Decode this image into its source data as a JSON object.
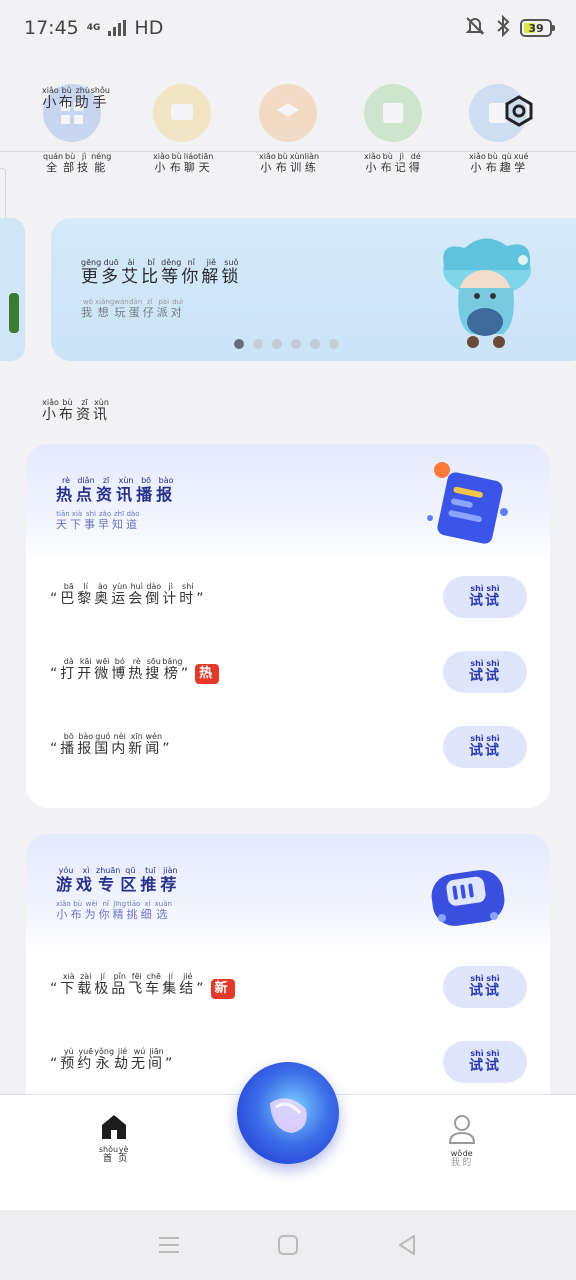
{
  "status_bar": {
    "time": "17:45",
    "network": "4G",
    "hd": "HD",
    "battery": "39"
  },
  "header": {
    "title": [
      {
        "h": "小",
        "p": "xiǎo"
      },
      {
        "h": "布",
        "p": "bù"
      },
      {
        "h": "助",
        "p": "zhù"
      },
      {
        "h": "手",
        "p": "shǒu"
      }
    ],
    "settings_icon": "settings-hexagon-icon"
  },
  "skills": [
    {
      "id": "all",
      "color": "#5f8ee6",
      "icon": "grid-icon",
      "label": [
        {
          "h": "全",
          "p": "quán"
        },
        {
          "h": "部",
          "p": "bù"
        },
        {
          "h": "技",
          "p": "jì"
        },
        {
          "h": "能",
          "p": "néng"
        }
      ]
    },
    {
      "id": "chat",
      "color": "#f2c44c",
      "icon": "chat-icon",
      "label": [
        {
          "h": "小",
          "p": "xiǎo"
        },
        {
          "h": "布",
          "p": "bù"
        },
        {
          "h": "聊",
          "p": "liáo"
        },
        {
          "h": "天",
          "p": "tiān"
        }
      ]
    },
    {
      "id": "train",
      "color": "#f3a050",
      "icon": "layers-icon",
      "label": [
        {
          "h": "小",
          "p": "xiǎo"
        },
        {
          "h": "布",
          "p": "bù"
        },
        {
          "h": "训",
          "p": "xùn"
        },
        {
          "h": "练",
          "p": "liàn"
        }
      ]
    },
    {
      "id": "notes",
      "color": "#6fc36a",
      "icon": "list-icon",
      "label": [
        {
          "h": "小",
          "p": "xiǎo"
        },
        {
          "h": "布",
          "p": "bù"
        },
        {
          "h": "记",
          "p": "jì"
        },
        {
          "h": "得",
          "p": "dé"
        }
      ]
    },
    {
      "id": "fun",
      "color": "#76a8f0",
      "icon": "book-icon",
      "label": [
        {
          "h": "小",
          "p": "xiǎo"
        },
        {
          "h": "布",
          "p": "bù"
        },
        {
          "h": "趣",
          "p": "qù"
        },
        {
          "h": "学",
          "p": "xué"
        }
      ]
    }
  ],
  "banner": {
    "title": [
      {
        "h": "更",
        "p": "gēng"
      },
      {
        "h": "多",
        "p": "duō"
      },
      {
        "h": "艾",
        "p": "ài"
      },
      {
        "h": "比",
        "p": "bǐ"
      },
      {
        "h": "等",
        "p": "děng"
      },
      {
        "h": "你",
        "p": "nǐ"
      },
      {
        "h": "解",
        "p": "jiě"
      },
      {
        "h": "锁",
        "p": "suǒ"
      }
    ],
    "subtitle": [
      {
        "h": "我",
        "p": "wǒ"
      },
      {
        "h": "想",
        "p": "xiǎng"
      },
      {
        "h": "玩",
        "p": "wán"
      },
      {
        "h": "蛋",
        "p": "dàn"
      },
      {
        "h": "仔",
        "p": "zǐ"
      },
      {
        "h": "派",
        "p": "pài"
      },
      {
        "h": "对",
        "p": "duì"
      }
    ],
    "active_dot": 0,
    "dot_count": 6
  },
  "section": {
    "title": [
      {
        "h": "小",
        "p": "xiǎo"
      },
      {
        "h": "布",
        "p": "bù"
      },
      {
        "h": "资",
        "p": "zī"
      },
      {
        "h": "讯",
        "p": "xùn"
      }
    ]
  },
  "try_label": [
    {
      "h": "试",
      "p": "shì"
    },
    {
      "h": "试",
      "p": "shì"
    }
  ],
  "news_card": {
    "title": [
      {
        "h": "热",
        "p": "rè"
      },
      {
        "h": "点",
        "p": "diǎn"
      },
      {
        "h": "资",
        "p": "zī"
      },
      {
        "h": "讯",
        "p": "xùn"
      },
      {
        "h": "播",
        "p": "bō"
      },
      {
        "h": "报",
        "p": "bào"
      }
    ],
    "subtitle": [
      {
        "h": "天",
        "p": "tiān"
      },
      {
        "h": "下",
        "p": "xià"
      },
      {
        "h": "事",
        "p": "shì"
      },
      {
        "h": "早",
        "p": "zǎo"
      },
      {
        "h": "知",
        "p": "zhī"
      },
      {
        "h": "道",
        "p": "dào"
      }
    ],
    "items": [
      {
        "text": [
          {
            "h": "巴",
            "p": "bā"
          },
          {
            "h": "黎",
            "p": "lí"
          },
          {
            "h": "奥",
            "p": "ào"
          },
          {
            "h": "运",
            "p": "yùn"
          },
          {
            "h": "会",
            "p": "huì"
          },
          {
            "h": "倒",
            "p": "dào"
          },
          {
            "h": "计",
            "p": "jì"
          },
          {
            "h": "时",
            "p": "shí"
          }
        ],
        "badge": ""
      },
      {
        "text": [
          {
            "h": "打",
            "p": "dǎ"
          },
          {
            "h": "开",
            "p": "kāi"
          },
          {
            "h": "微",
            "p": "wēi"
          },
          {
            "h": "博",
            "p": "bó"
          },
          {
            "h": "热",
            "p": "rè"
          },
          {
            "h": "搜",
            "p": "sōu"
          },
          {
            "h": "榜",
            "p": "bǎng"
          }
        ],
        "badge": "热"
      },
      {
        "text": [
          {
            "h": "播",
            "p": "bō"
          },
          {
            "h": "报",
            "p": "bào"
          },
          {
            "h": "国",
            "p": "guó"
          },
          {
            "h": "内",
            "p": "nèi"
          },
          {
            "h": "新",
            "p": "xīn"
          },
          {
            "h": "闻",
            "p": "wén"
          }
        ],
        "badge": ""
      }
    ]
  },
  "game_card": {
    "title": [
      {
        "h": "游",
        "p": "yóu"
      },
      {
        "h": "戏",
        "p": "xì"
      },
      {
        "h": "专",
        "p": "zhuān"
      },
      {
        "h": "区",
        "p": "qū"
      },
      {
        "h": "推",
        "p": "tuī"
      },
      {
        "h": "荐",
        "p": "jiàn"
      }
    ],
    "subtitle": [
      {
        "h": "小",
        "p": "xiǎo"
      },
      {
        "h": "布",
        "p": "bù"
      },
      {
        "h": "为",
        "p": "wèi"
      },
      {
        "h": "你",
        "p": "nǐ"
      },
      {
        "h": "精",
        "p": "jīng"
      },
      {
        "h": "挑",
        "p": "tiāo"
      },
      {
        "h": "细",
        "p": "xì"
      },
      {
        "h": "选",
        "p": "xuǎn"
      }
    ],
    "items": [
      {
        "text": [
          {
            "h": "下",
            "p": "xià"
          },
          {
            "h": "载",
            "p": "zài"
          },
          {
            "h": "极",
            "p": "jí"
          },
          {
            "h": "品",
            "p": "pǐn"
          },
          {
            "h": "飞",
            "p": "fēi"
          },
          {
            "h": "车",
            "p": "chē"
          },
          {
            "h": "集",
            "p": "jí"
          },
          {
            "h": "结",
            "p": "jié"
          }
        ],
        "badge": "新"
      },
      {
        "text": [
          {
            "h": "预",
            "p": "yù"
          },
          {
            "h": "约",
            "p": "yuē"
          },
          {
            "h": "永",
            "p": "yǒng"
          },
          {
            "h": "劫",
            "p": "jié"
          },
          {
            "h": "无",
            "p": "wú"
          },
          {
            "h": "间",
            "p": "jiān"
          }
        ],
        "badge": ""
      }
    ]
  },
  "bottom_nav": {
    "home": [
      {
        "h": "首",
        "p": "shǒu"
      },
      {
        "h": "页",
        "p": "yè"
      }
    ],
    "profile": [
      {
        "h": "我",
        "p": "wǒ"
      },
      {
        "h": "的",
        "p": "de"
      }
    ]
  },
  "colors": {
    "accent": "#2d3bb0",
    "badge": "#e23a2a",
    "banner_bg": "#d5eafb",
    "button_bg": "#dfe6fb"
  }
}
